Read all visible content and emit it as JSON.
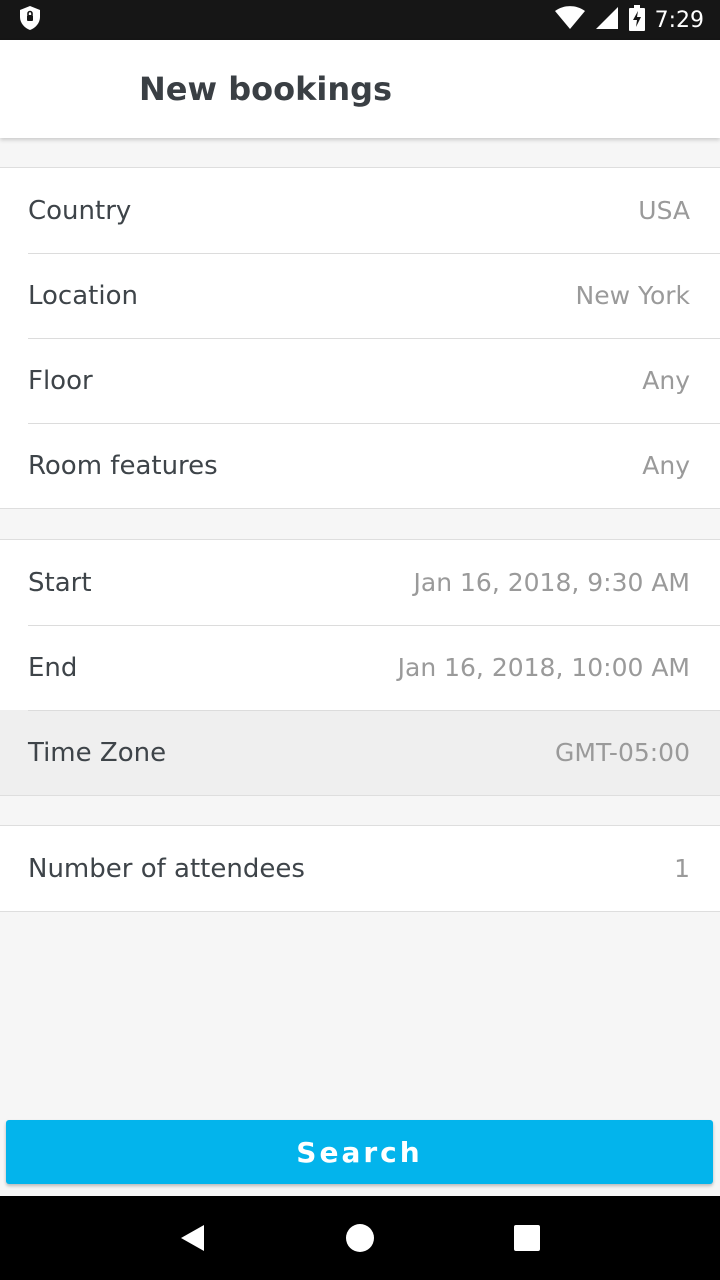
{
  "status_bar": {
    "time": "7:29",
    "icons": [
      "shield-icon",
      "wifi-icon",
      "signal-icon",
      "battery-charging-icon"
    ]
  },
  "app_bar": {
    "title": "New bookings"
  },
  "location_group": {
    "rows": [
      {
        "label": "Country",
        "value": "USA"
      },
      {
        "label": "Location",
        "value": "New York"
      },
      {
        "label": "Floor",
        "value": "Any"
      },
      {
        "label": "Room features",
        "value": "Any"
      }
    ]
  },
  "time_group": {
    "rows": [
      {
        "label": "Start",
        "value": "Jan 16, 2018, 9:30 AM"
      },
      {
        "label": "End",
        "value": "Jan 16, 2018, 10:00 AM"
      },
      {
        "label": "Time Zone",
        "value": "GMT-05:00"
      }
    ]
  },
  "attendees_group": {
    "rows": [
      {
        "label": "Number of attendees",
        "value": "1"
      }
    ]
  },
  "search_button": {
    "label": "Search"
  },
  "nav_bar": {
    "icons": [
      "back-icon",
      "home-icon",
      "recents-icon"
    ]
  },
  "colors": {
    "accent": "#03b4ec",
    "status_bar": "#161616",
    "background": "#f6f6f6"
  }
}
